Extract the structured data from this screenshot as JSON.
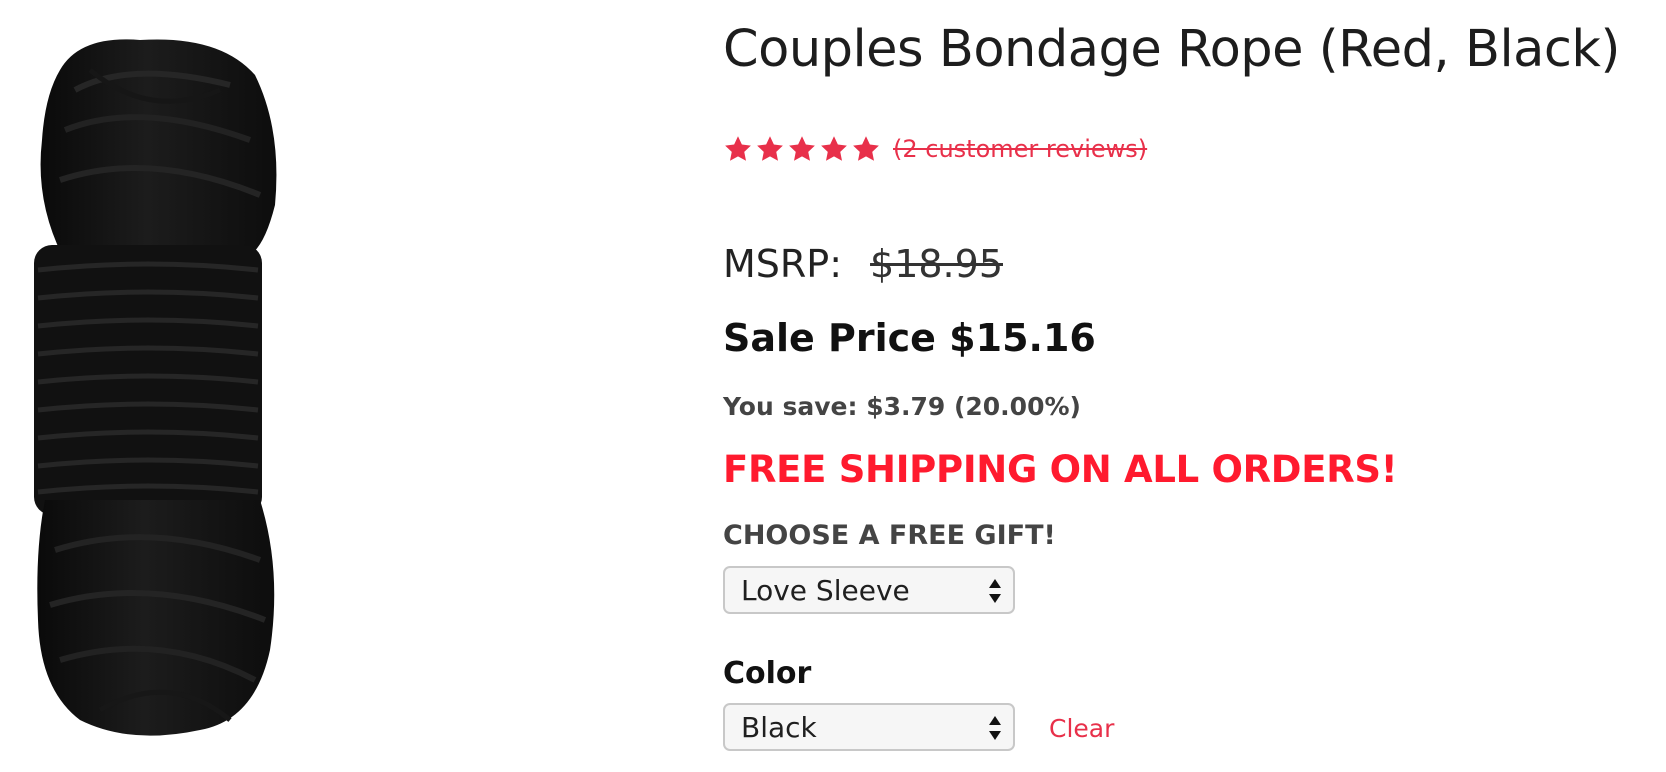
{
  "product": {
    "title": "Couples Bondage Rope (Red, Black)",
    "image_alt": "black rope coil",
    "rating": {
      "stars": 5,
      "max_stars": 5,
      "reviews_text": "(2 customer reviews)"
    },
    "msrp_label": "MSRP:",
    "msrp_price": "$18.95",
    "sale_price": "Sale Price $15.16",
    "savings": "You save: $3.79 (20.00%)",
    "shipping_banner": "FREE SHIPPING ON ALL ORDERS!",
    "gift": {
      "label": "CHOOSE A FREE GIFT!",
      "selected": "Love Sleeve"
    },
    "color": {
      "label": "Color",
      "selected": "Black",
      "clear_label": "Clear"
    }
  },
  "colors": {
    "accent": "#e8304a",
    "shipping": "#ff1a2e",
    "star": "#e8304a"
  },
  "icons": {
    "star": "star-icon",
    "select_arrows": "select-arrows-icon"
  }
}
